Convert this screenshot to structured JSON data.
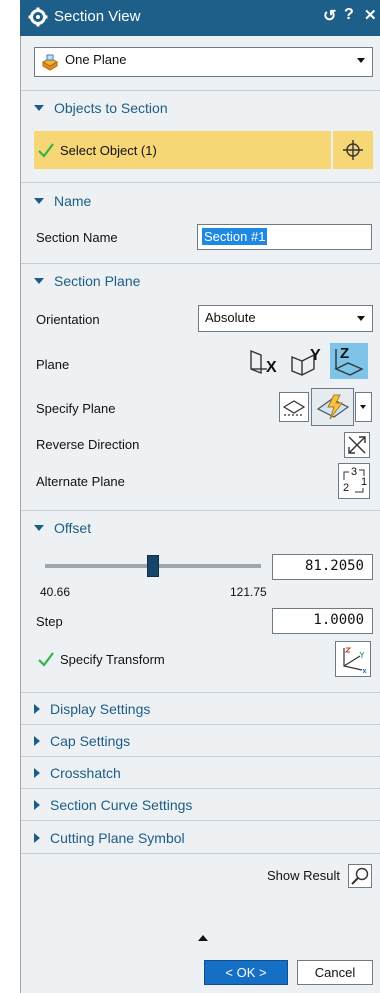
{
  "window": {
    "title": "Section View",
    "reset_glyph": "↺",
    "help_glyph": "?",
    "close_glyph": "✕"
  },
  "type_dropdown": {
    "value": "One Plane"
  },
  "objects_to_section": {
    "header": "Objects to Section",
    "select_label": "Select Object (1)",
    "highlight_color": "#f7d675"
  },
  "name": {
    "header": "Name",
    "field_label": "Section Name",
    "value": "Section #1"
  },
  "section_plane": {
    "header": "Section Plane",
    "orientation_label": "Orientation",
    "orientation_value": "Absolute",
    "plane_label": "Plane",
    "plane_axes": [
      "X",
      "Y",
      "Z"
    ],
    "specify_plane_label": "Specify Plane",
    "reverse_direction_label": "Reverse Direction",
    "alternate_plane_label": "Alternate Plane",
    "alternate_top": "3",
    "alternate_bottom": "2",
    "alternate_right": "1"
  },
  "offset": {
    "header": "Offset",
    "value": "81.2050",
    "min": "40.66",
    "max": "121.75",
    "slider_fraction": 0.5,
    "step_label": "Step",
    "step_value": "1.0000",
    "transform_label": "Specify Transform"
  },
  "collapsed_sections": [
    "Display Settings",
    "Cap Settings",
    "Crosshatch",
    "Section Curve Settings",
    "Cutting Plane Symbol"
  ],
  "show_result_label": "Show Result",
  "footer": {
    "ok_label": "< OK >",
    "cancel_label": "Cancel"
  },
  "colors": {
    "title_bar": "#1d5f88",
    "section_text": "#1c5d86",
    "accent_blue": "#1e88e5",
    "ok_button": "#1570c5"
  }
}
